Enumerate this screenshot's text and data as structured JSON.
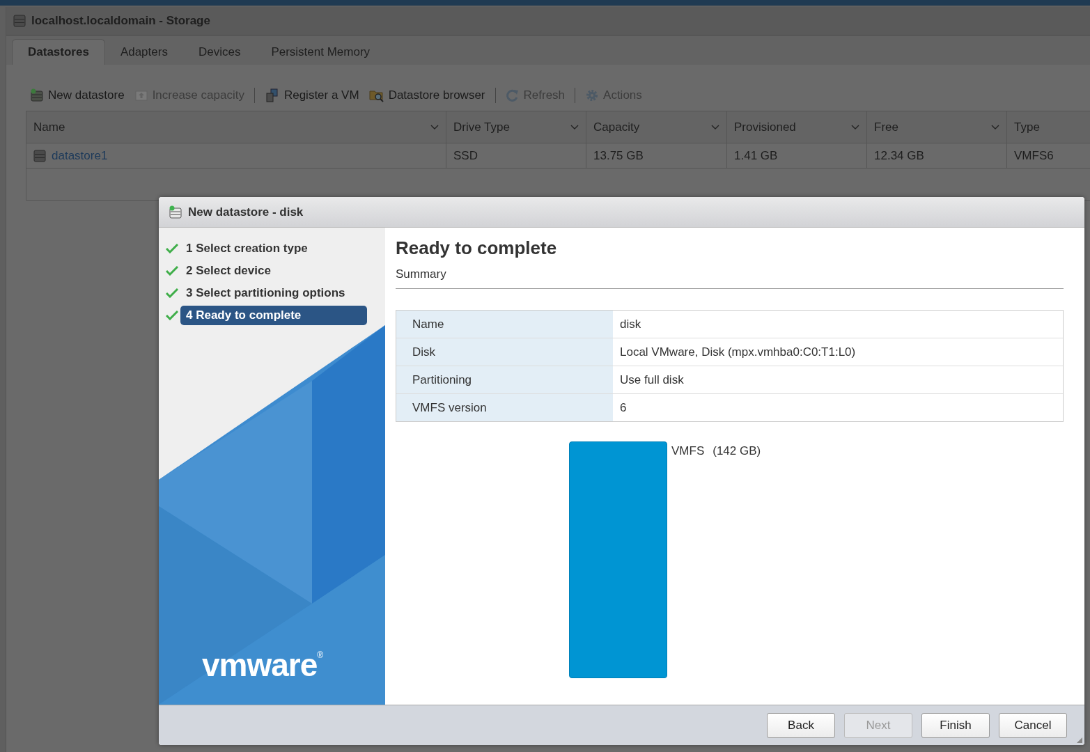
{
  "window": {
    "title": "localhost.localdomain - Storage"
  },
  "tabs": [
    {
      "label": "Datastores",
      "selected": true
    },
    {
      "label": "Adapters",
      "selected": false
    },
    {
      "label": "Devices",
      "selected": false
    },
    {
      "label": "Persistent Memory",
      "selected": false
    }
  ],
  "toolbar": [
    {
      "kind": "button",
      "label": "New datastore",
      "disabled": false
    },
    {
      "kind": "button",
      "label": "Increase capacity",
      "disabled": true
    },
    {
      "kind": "separator"
    },
    {
      "kind": "button",
      "label": "Register a VM",
      "disabled": false
    },
    {
      "kind": "button",
      "label": "Datastore browser",
      "disabled": false
    },
    {
      "kind": "separator"
    },
    {
      "kind": "button",
      "label": "Refresh",
      "disabled": true
    },
    {
      "kind": "separator"
    },
    {
      "kind": "button",
      "label": "Actions",
      "disabled": true
    }
  ],
  "table": {
    "columns": [
      "Name",
      "Drive Type",
      "Capacity",
      "Provisioned",
      "Free",
      "Type"
    ],
    "rows": [
      [
        "datastore1",
        "SSD",
        "13.75 GB",
        "1.41 GB",
        "12.34 GB",
        "VMFS6"
      ]
    ]
  },
  "dialog": {
    "title": "New datastore - disk",
    "steps": [
      {
        "label": "1 Select creation type",
        "done": true,
        "selected": false
      },
      {
        "label": "2 Select device",
        "done": true,
        "selected": false
      },
      {
        "label": "3 Select partitioning options",
        "done": true,
        "selected": false
      },
      {
        "label": "4 Ready to complete",
        "done": true,
        "selected": true
      }
    ],
    "logo": "vmware$^{®}$",
    "heading": "Ready to complete",
    "subheading": "Summary",
    "summary": [
      {
        "key": "Name",
        "value": "disk"
      },
      {
        "key": "Disk",
        "value": "Local VMware, Disk (mpx.vmhba0:C0:T1:L0)"
      },
      {
        "key": "Partitioning",
        "value": "Use full disk"
      },
      {
        "key": "VMFS version",
        "value": "6"
      }
    ],
    "partition": {
      "name": "VMFS",
      "size": "(142 GB)"
    },
    "buttons": [
      {
        "label": "Back",
        "disabled": false
      },
      {
        "label": "Next",
        "disabled": true
      },
      {
        "label": "Finish",
        "disabled": false
      },
      {
        "label": "Cancel",
        "disabled": false
      }
    ]
  }
}
